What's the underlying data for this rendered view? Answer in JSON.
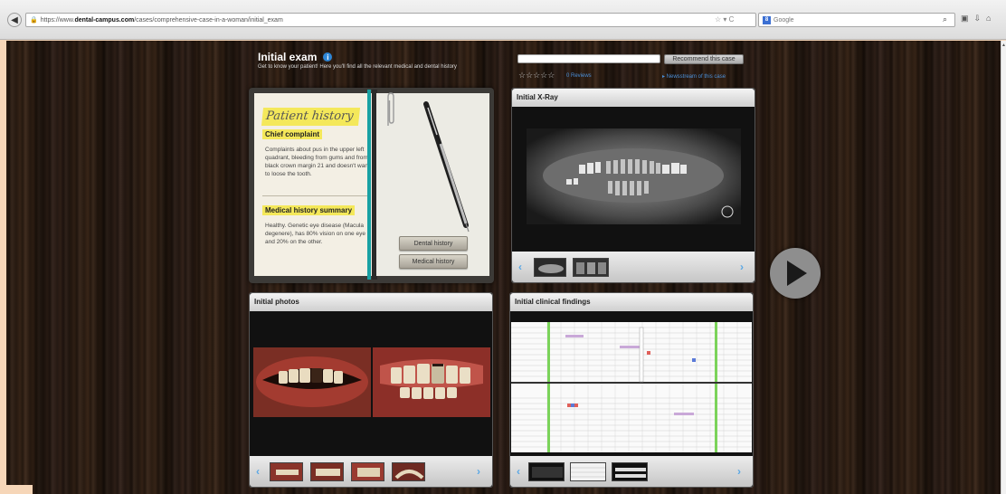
{
  "browser": {
    "url_prefix": "https://www.",
    "url_domain": "dental-campus.com",
    "url_path": "/cases/comprehensive-case-in-a-woman/initial_exam",
    "url_icons": "☆ ▾ C",
    "search_placeholder": "Google",
    "search_engine_letter": "8"
  },
  "header": {
    "title": "Initial exam",
    "info_icon": "i",
    "subtitle": "Get to know your patient! Here you'll find all the relevant medical and dental history"
  },
  "recommend": {
    "button_label": "Recommend this case",
    "stars": "☆☆☆☆☆",
    "reviews_label": "0 Reviews",
    "newsstream_label": "▸ Newsstream of this case"
  },
  "notebook": {
    "title": "Patient history",
    "chief_complaint_label": "Chief complaint",
    "chief_complaint_text": "Complaints about pus in the upper left quadrant, bleeding from gums and from black crown margin 21 and doesn't want to loose the tooth.",
    "medical_summary_label": "Medical history summary",
    "medical_summary_text": "Healthy. Genetic eye disease (Macula degenere), has 80% vision on one eye and 20% on the other.",
    "dental_history_button": "Dental history",
    "medical_history_button": "Medical history"
  },
  "panels": {
    "xray_title": "Initial X-Ray",
    "photos_title": "Initial photos",
    "findings_title": "Initial clinical findings"
  },
  "colors": {
    "accent_blue": "#59a7e5",
    "highlight_yellow": "#f4e85a",
    "binding_teal": "#18a1a3"
  }
}
